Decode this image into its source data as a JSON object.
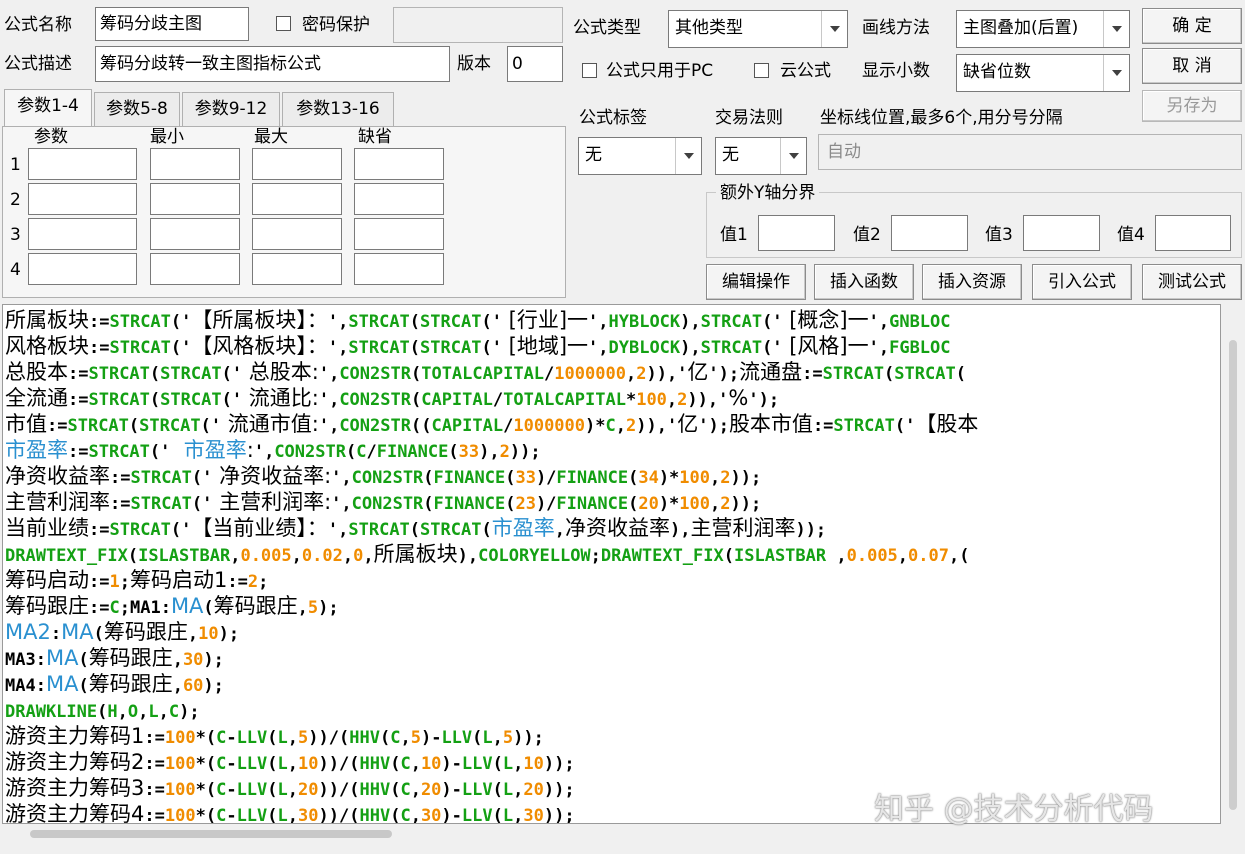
{
  "top": {
    "formula_name_label": "公式名称",
    "formula_name_value": "筹码分歧主图",
    "password_label": "密码保护",
    "formula_desc_label": "公式描述",
    "formula_desc_value": "筹码分歧转一致主图指标公式",
    "version_label": "版本",
    "version_value": "0",
    "formula_type_label": "公式类型",
    "formula_type_value": "其他类型",
    "draw_method_label": "画线方法",
    "draw_method_value": "主图叠加(后置)",
    "pc_only_label": "公式只用于PC",
    "cloud_label": "云公式",
    "decimals_label": "显示小数",
    "decimals_value": "缺省位数"
  },
  "buttons": {
    "ok": "确  定",
    "cancel": "取  消",
    "save_as": "另存为",
    "edit_ops": "编辑操作",
    "insert_func": "插入函数",
    "insert_res": "插入资源",
    "import_formula": "引入公式",
    "test_formula": "测试公式"
  },
  "tabs": [
    "参数1-4",
    "参数5-8",
    "参数9-12",
    "参数13-16"
  ],
  "params": {
    "headers": [
      "参数",
      "最小",
      "最大",
      "缺省"
    ],
    "rows": [
      "1",
      "2",
      "3",
      "4"
    ]
  },
  "options": {
    "tag_label": "公式标签",
    "tag_value": "无",
    "trade_label": "交易法则",
    "trade_value": "无",
    "coord_label": "坐标线位置,最多6个,用分号分隔",
    "coord_placeholder": "自动",
    "extra_y_label": "额外Y轴分界",
    "v1": "值1",
    "v2": "值2",
    "v3": "值3",
    "v4": "值4"
  },
  "code_lines": [
    [
      [
        "t",
        "所属板块"
      ],
      [
        "op",
        ":="
      ],
      [
        "kw",
        "STRCAT"
      ],
      [
        "op",
        "('"
      ],
      [
        "t",
        "【所属板块】："
      ],
      [
        "op",
        "',"
      ],
      [
        "kw",
        "STRCAT"
      ],
      [
        "op",
        "("
      ],
      [
        "kw",
        "STRCAT"
      ],
      [
        "op",
        "('"
      ],
      [
        "t",
        " [行业]一"
      ],
      [
        "op",
        "',"
      ],
      [
        "kw",
        "HYBLOCK"
      ],
      [
        "op",
        "),"
      ],
      [
        "kw",
        "STRCAT"
      ],
      [
        "op",
        "('"
      ],
      [
        "t",
        " [概念]一"
      ],
      [
        "op",
        "',"
      ],
      [
        "kw",
        "GNBLOC"
      ]
    ],
    [
      [
        "t",
        "风格板块"
      ],
      [
        "op",
        ":="
      ],
      [
        "kw",
        "STRCAT"
      ],
      [
        "op",
        "('"
      ],
      [
        "t",
        "【风格板块】："
      ],
      [
        "op",
        "',"
      ],
      [
        "kw",
        "STRCAT"
      ],
      [
        "op",
        "("
      ],
      [
        "kw",
        "STRCAT"
      ],
      [
        "op",
        "('"
      ],
      [
        "t",
        " [地域]一"
      ],
      [
        "op",
        "',"
      ],
      [
        "kw",
        "DYBLOCK"
      ],
      [
        "op",
        "),"
      ],
      [
        "kw",
        "STRCAT"
      ],
      [
        "op",
        "('"
      ],
      [
        "t",
        " [风格]一"
      ],
      [
        "op",
        "',"
      ],
      [
        "kw",
        "FGBLOC"
      ]
    ],
    [
      [
        "t",
        "总股本"
      ],
      [
        "op",
        ":="
      ],
      [
        "kw",
        "STRCAT"
      ],
      [
        "op",
        "("
      ],
      [
        "kw",
        "STRCAT"
      ],
      [
        "op",
        "('"
      ],
      [
        "t",
        " 总股本:"
      ],
      [
        "op",
        "',"
      ],
      [
        "kw",
        "CON2STR"
      ],
      [
        "op",
        "("
      ],
      [
        "kw",
        "TOTALCAPITAL"
      ],
      [
        "op",
        "/"
      ],
      [
        "num",
        "1000000"
      ],
      [
        "op",
        ","
      ],
      [
        "num",
        "2"
      ],
      [
        "op",
        "))"
      ],
      [
        "op",
        ",'"
      ],
      [
        "t",
        "亿"
      ],
      [
        "op",
        "');"
      ],
      [
        "t",
        "流通盘"
      ],
      [
        "op",
        ":="
      ],
      [
        "kw",
        "STRCAT"
      ],
      [
        "op",
        "("
      ],
      [
        "kw",
        "STRCAT"
      ],
      [
        "op",
        "("
      ]
    ],
    [
      [
        "t",
        "全流通"
      ],
      [
        "op",
        ":="
      ],
      [
        "kw",
        "STRCAT"
      ],
      [
        "op",
        "("
      ],
      [
        "kw",
        "STRCAT"
      ],
      [
        "op",
        "('"
      ],
      [
        "t",
        " 流通比:"
      ],
      [
        "op",
        "',"
      ],
      [
        "kw",
        "CON2STR"
      ],
      [
        "op",
        "("
      ],
      [
        "kw",
        "CAPITAL"
      ],
      [
        "op",
        "/"
      ],
      [
        "kw",
        "TOTALCAPITAL"
      ],
      [
        "op",
        "*"
      ],
      [
        "num",
        "100"
      ],
      [
        "op",
        ","
      ],
      [
        "num",
        "2"
      ],
      [
        "op",
        "))"
      ],
      [
        "op",
        ",'"
      ],
      [
        "t",
        "%"
      ],
      [
        "op",
        "');"
      ]
    ],
    [
      [
        "t",
        "市值"
      ],
      [
        "op",
        ":="
      ],
      [
        "kw",
        "STRCAT"
      ],
      [
        "op",
        "("
      ],
      [
        "kw",
        "STRCAT"
      ],
      [
        "op",
        "('"
      ],
      [
        "t",
        " 流通市值:"
      ],
      [
        "op",
        "',"
      ],
      [
        "kw",
        "CON2STR"
      ],
      [
        "op",
        "(("
      ],
      [
        "kw",
        "CAPITAL"
      ],
      [
        "op",
        "/"
      ],
      [
        "num",
        "1000000"
      ],
      [
        "op",
        ")*"
      ],
      [
        "kw",
        "C"
      ],
      [
        "op",
        ","
      ],
      [
        "num",
        "2"
      ],
      [
        "op",
        "))"
      ],
      [
        "op",
        ",'"
      ],
      [
        "t",
        "亿"
      ],
      [
        "op",
        "');"
      ],
      [
        "t",
        "股本市值"
      ],
      [
        "op",
        ":="
      ],
      [
        "kw",
        "STRCAT"
      ],
      [
        "op",
        "('"
      ],
      [
        "t",
        "【股本"
      ]
    ],
    [
      [
        "hl",
        "市盈率"
      ],
      [
        "op",
        ":="
      ],
      [
        "kw",
        "STRCAT"
      ],
      [
        "op",
        "('"
      ],
      [
        "t",
        "  "
      ],
      [
        "hl",
        "市盈率"
      ],
      [
        "t",
        ":"
      ],
      [
        "op",
        "',"
      ],
      [
        "kw",
        "CON2STR"
      ],
      [
        "op",
        "("
      ],
      [
        "kw",
        "C"
      ],
      [
        "op",
        "/"
      ],
      [
        "kw",
        "FINANCE"
      ],
      [
        "op",
        "("
      ],
      [
        "num",
        "33"
      ],
      [
        "op",
        "),"
      ],
      [
        "num",
        "2"
      ],
      [
        "op",
        "));"
      ]
    ],
    [
      [
        "t",
        "净资收益率"
      ],
      [
        "op",
        ":="
      ],
      [
        "kw",
        "STRCAT"
      ],
      [
        "op",
        "('"
      ],
      [
        "t",
        " 净资收益率:"
      ],
      [
        "op",
        "',"
      ],
      [
        "kw",
        "CON2STR"
      ],
      [
        "op",
        "("
      ],
      [
        "kw",
        "FINANCE"
      ],
      [
        "op",
        "("
      ],
      [
        "num",
        "33"
      ],
      [
        "op",
        ")/"
      ],
      [
        "kw",
        "FINANCE"
      ],
      [
        "op",
        "("
      ],
      [
        "num",
        "34"
      ],
      [
        "op",
        ")*"
      ],
      [
        "num",
        "100"
      ],
      [
        "op",
        ","
      ],
      [
        "num",
        "2"
      ],
      [
        "op",
        "));"
      ]
    ],
    [
      [
        "t",
        "主营利润率"
      ],
      [
        "op",
        ":="
      ],
      [
        "kw",
        "STRCAT"
      ],
      [
        "op",
        "('"
      ],
      [
        "t",
        " 主营利润率:"
      ],
      [
        "op",
        "',"
      ],
      [
        "kw",
        "CON2STR"
      ],
      [
        "op",
        "("
      ],
      [
        "kw",
        "FINANCE"
      ],
      [
        "op",
        "("
      ],
      [
        "num",
        "23"
      ],
      [
        "op",
        ")/"
      ],
      [
        "kw",
        "FINANCE"
      ],
      [
        "op",
        "("
      ],
      [
        "num",
        "20"
      ],
      [
        "op",
        ")*"
      ],
      [
        "num",
        "100"
      ],
      [
        "op",
        ","
      ],
      [
        "num",
        "2"
      ],
      [
        "op",
        "));"
      ]
    ],
    [
      [
        "t",
        "当前业绩"
      ],
      [
        "op",
        ":="
      ],
      [
        "kw",
        "STRCAT"
      ],
      [
        "op",
        "('"
      ],
      [
        "t",
        "【当前业绩】："
      ],
      [
        "op",
        "',"
      ],
      [
        "kw",
        "STRCAT"
      ],
      [
        "op",
        "("
      ],
      [
        "kw",
        "STRCAT"
      ],
      [
        "op",
        "("
      ],
      [
        "hl",
        "市盈率"
      ],
      [
        "op",
        ","
      ],
      [
        "t",
        "净资收益率"
      ],
      [
        "op",
        "),"
      ],
      [
        "t",
        "主营利润率"
      ],
      [
        "op",
        "));"
      ]
    ],
    [
      [
        "kw",
        "DRAWTEXT_FIX"
      ],
      [
        "op",
        "("
      ],
      [
        "kw",
        "ISLASTBAR"
      ],
      [
        "op",
        ","
      ],
      [
        "num",
        "0.005"
      ],
      [
        "op",
        ","
      ],
      [
        "num",
        "0.02"
      ],
      [
        "op",
        ","
      ],
      [
        "num",
        "0"
      ],
      [
        "op",
        ","
      ],
      [
        "t",
        "所属板块"
      ],
      [
        "op",
        "),"
      ],
      [
        "kw",
        "COLORYELLOW"
      ],
      [
        "op",
        ";"
      ],
      [
        "kw",
        "DRAWTEXT_FIX"
      ],
      [
        "op",
        "("
      ],
      [
        "kw",
        "ISLASTBAR"
      ],
      [
        "op",
        " ,"
      ],
      [
        "num",
        "0.005"
      ],
      [
        "op",
        ","
      ],
      [
        "num",
        "0.07"
      ],
      [
        "op",
        ",("
      ]
    ],
    [
      [
        "t",
        "筹码启动"
      ],
      [
        "op",
        ":="
      ],
      [
        "num",
        "1"
      ],
      [
        "op",
        ";"
      ],
      [
        "t",
        "筹码启动1"
      ],
      [
        "op",
        ":="
      ],
      [
        "num",
        "2"
      ],
      [
        "op",
        ";"
      ]
    ],
    [
      [
        "t",
        "筹码跟庄"
      ],
      [
        "op",
        ":="
      ],
      [
        "kw",
        "C"
      ],
      [
        "op",
        ";"
      ],
      [
        "op",
        "MA1:"
      ],
      [
        "hl",
        "MA"
      ],
      [
        "op",
        "("
      ],
      [
        "t",
        "筹码跟庄"
      ],
      [
        "op",
        ","
      ],
      [
        "num",
        "5"
      ],
      [
        "op",
        ");"
      ]
    ],
    [
      [
        "hl",
        "MA2"
      ],
      [
        "op",
        ":"
      ],
      [
        "hl",
        "MA"
      ],
      [
        "op",
        "("
      ],
      [
        "t",
        "筹码跟庄"
      ],
      [
        "op",
        ","
      ],
      [
        "num",
        "10"
      ],
      [
        "op",
        ");"
      ]
    ],
    [
      [
        "op",
        "MA3:"
      ],
      [
        "hl",
        "MA"
      ],
      [
        "op",
        "("
      ],
      [
        "t",
        "筹码跟庄"
      ],
      [
        "op",
        ","
      ],
      [
        "num",
        "30"
      ],
      [
        "op",
        ");"
      ]
    ],
    [
      [
        "op",
        "MA4:"
      ],
      [
        "hl",
        "MA"
      ],
      [
        "op",
        "("
      ],
      [
        "t",
        "筹码跟庄"
      ],
      [
        "op",
        ","
      ],
      [
        "num",
        "60"
      ],
      [
        "op",
        ");"
      ]
    ],
    [
      [
        "kw",
        "DRAWKLINE"
      ],
      [
        "op",
        "("
      ],
      [
        "kw",
        "H"
      ],
      [
        "op",
        ","
      ],
      [
        "kw",
        "O"
      ],
      [
        "op",
        ","
      ],
      [
        "kw",
        "L"
      ],
      [
        "op",
        ","
      ],
      [
        "kw",
        "C"
      ],
      [
        "op",
        ");"
      ]
    ],
    [
      [
        "t",
        "游资主力筹码1"
      ],
      [
        "op",
        ":="
      ],
      [
        "num",
        "100"
      ],
      [
        "op",
        "*("
      ],
      [
        "kw",
        "C"
      ],
      [
        "op",
        "-"
      ],
      [
        "kw",
        "LLV"
      ],
      [
        "op",
        "("
      ],
      [
        "kw",
        "L"
      ],
      [
        "op",
        ","
      ],
      [
        "num",
        "5"
      ],
      [
        "op",
        "))/("
      ],
      [
        "kw",
        "HHV"
      ],
      [
        "op",
        "("
      ],
      [
        "kw",
        "C"
      ],
      [
        "op",
        ","
      ],
      [
        "num",
        "5"
      ],
      [
        "op",
        ")-"
      ],
      [
        "kw",
        "LLV"
      ],
      [
        "op",
        "("
      ],
      [
        "kw",
        "L"
      ],
      [
        "op",
        ","
      ],
      [
        "num",
        "5"
      ],
      [
        "op",
        "));"
      ]
    ],
    [
      [
        "t",
        "游资主力筹码2"
      ],
      [
        "op",
        ":="
      ],
      [
        "num",
        "100"
      ],
      [
        "op",
        "*("
      ],
      [
        "kw",
        "C"
      ],
      [
        "op",
        "-"
      ],
      [
        "kw",
        "LLV"
      ],
      [
        "op",
        "("
      ],
      [
        "kw",
        "L"
      ],
      [
        "op",
        ","
      ],
      [
        "num",
        "10"
      ],
      [
        "op",
        "))/("
      ],
      [
        "kw",
        "HHV"
      ],
      [
        "op",
        "("
      ],
      [
        "kw",
        "C"
      ],
      [
        "op",
        ","
      ],
      [
        "num",
        "10"
      ],
      [
        "op",
        ")-"
      ],
      [
        "kw",
        "LLV"
      ],
      [
        "op",
        "("
      ],
      [
        "kw",
        "L"
      ],
      [
        "op",
        ","
      ],
      [
        "num",
        "10"
      ],
      [
        "op",
        "));"
      ]
    ],
    [
      [
        "t",
        "游资主力筹码3"
      ],
      [
        "op",
        ":="
      ],
      [
        "num",
        "100"
      ],
      [
        "op",
        "*("
      ],
      [
        "kw",
        "C"
      ],
      [
        "op",
        "-"
      ],
      [
        "kw",
        "LLV"
      ],
      [
        "op",
        "("
      ],
      [
        "kw",
        "L"
      ],
      [
        "op",
        ","
      ],
      [
        "num",
        "20"
      ],
      [
        "op",
        "))/("
      ],
      [
        "kw",
        "HHV"
      ],
      [
        "op",
        "("
      ],
      [
        "kw",
        "C"
      ],
      [
        "op",
        ","
      ],
      [
        "num",
        "20"
      ],
      [
        "op",
        ")-"
      ],
      [
        "kw",
        "LLV"
      ],
      [
        "op",
        "("
      ],
      [
        "kw",
        "L"
      ],
      [
        "op",
        ","
      ],
      [
        "num",
        "20"
      ],
      [
        "op",
        "));"
      ]
    ],
    [
      [
        "t",
        "游资主力筹码4"
      ],
      [
        "op",
        ":="
      ],
      [
        "num",
        "100"
      ],
      [
        "op",
        "*("
      ],
      [
        "kw",
        "C"
      ],
      [
        "op",
        "-"
      ],
      [
        "kw",
        "LLV"
      ],
      [
        "op",
        "("
      ],
      [
        "kw",
        "L"
      ],
      [
        "op",
        ","
      ],
      [
        "num",
        "30"
      ],
      [
        "op",
        "))/("
      ],
      [
        "kw",
        "HHV"
      ],
      [
        "op",
        "("
      ],
      [
        "kw",
        "C"
      ],
      [
        "op",
        ","
      ],
      [
        "num",
        "30"
      ],
      [
        "op",
        ")-"
      ],
      [
        "kw",
        "LLV"
      ],
      [
        "op",
        "("
      ],
      [
        "kw",
        "L"
      ],
      [
        "op",
        ","
      ],
      [
        "num",
        "30"
      ],
      [
        "op",
        "));"
      ]
    ]
  ],
  "watermark": "知乎 @技术分析代码"
}
